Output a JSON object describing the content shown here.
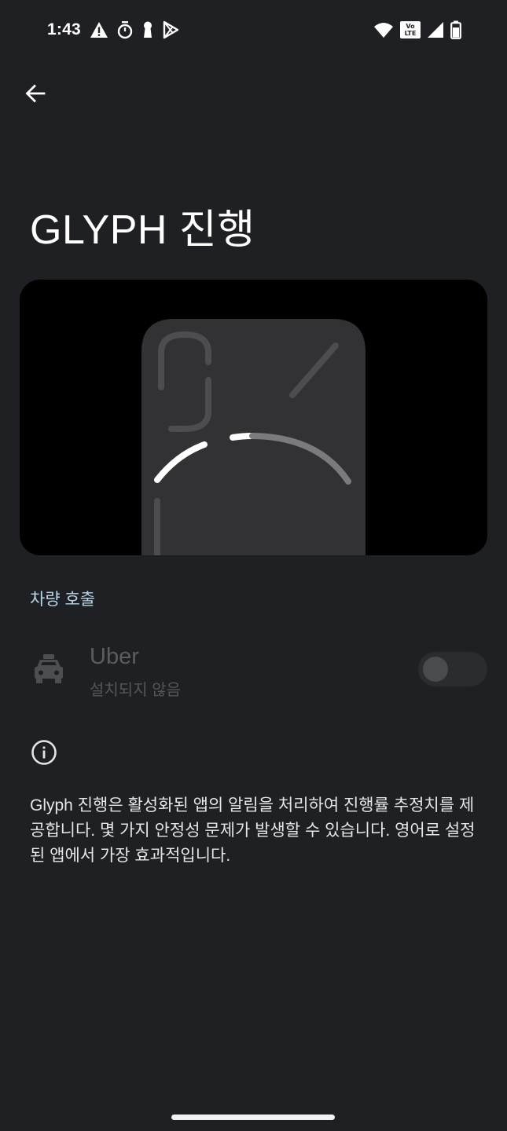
{
  "status_bar": {
    "time": "1:43",
    "icons_left": [
      "warning-icon",
      "stopwatch-icon",
      "keyhole-icon",
      "play-store-icon"
    ],
    "icons_right": [
      "wifi-icon",
      "volte-icon",
      "signal-icon",
      "battery-icon"
    ],
    "volte_top": "Vo",
    "volte_bottom": "LTE"
  },
  "header": {
    "title": "GLYPH 진행"
  },
  "preview": {
    "description_icon": "glyph-phone-back-illustration"
  },
  "section": {
    "title": "차량 호출"
  },
  "apps": [
    {
      "name": "Uber",
      "status": "설치되지 않음",
      "icon": "taxi-icon",
      "enabled": false
    }
  ],
  "info": {
    "icon": "info-icon",
    "text": "Glyph 진행은 활성화된 앱의 알림을 처리하여 진행률 추정치를 제공합니다. 몇 가지 안정성 문제가 발생할 수 있습니다. 영어로 설정된 앱에서 가장 효과적입니다."
  },
  "colors": {
    "background": "#1f2023",
    "accent": "#b7d6ea",
    "disabled_text": "#5b5d61"
  }
}
